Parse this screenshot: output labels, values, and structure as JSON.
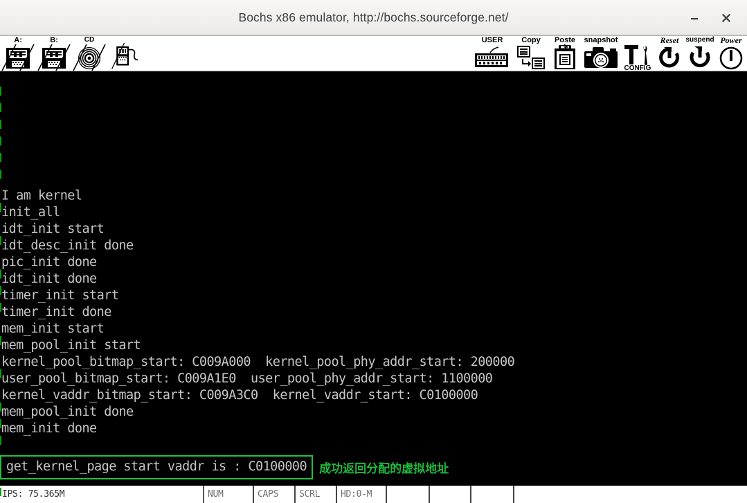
{
  "window": {
    "title": "Bochs x86 emulator, http://bochs.sourceforge.net/",
    "minimize_label": "–",
    "close_label": "×",
    "minimize_icon": "minimize-icon",
    "close_icon": "close-icon"
  },
  "toolbar": {
    "left_items": [
      {
        "label": "A:",
        "icon": "floppy-a-icon",
        "disabled": true
      },
      {
        "label": "B:",
        "icon": "floppy-b-icon",
        "disabled": true
      },
      {
        "label": "CD",
        "icon": "cdrom-icon",
        "disabled": true
      },
      {
        "label": "",
        "icon": "usb-device-icon",
        "disabled": true
      }
    ],
    "right_items": [
      {
        "label": "USER",
        "icon": "keyboard-icon",
        "under": ""
      },
      {
        "label": "Copy",
        "icon": "copy-icon",
        "under": ""
      },
      {
        "label": "Poste",
        "icon": "paste-icon",
        "under": ""
      },
      {
        "label": "snapshot",
        "icon": "camera-icon",
        "under": ""
      },
      {
        "label": "",
        "icon": "config-tools-icon",
        "under": "CONFIG"
      },
      {
        "label": "Reset",
        "icon": "reset-icon",
        "under": ""
      },
      {
        "label": "suspend",
        "icon": "suspend-icon",
        "under": ""
      },
      {
        "label": "Power",
        "icon": "power-icon",
        "under": ""
      }
    ]
  },
  "console": {
    "lines": [
      "",
      "",
      "",
      "",
      "",
      "",
      "",
      "I am kernel",
      "init_all",
      "idt_init start",
      "idt_desc_init done",
      "pic_init done",
      "idt_init done",
      "timer_init start",
      "timer_init done",
      "mem_init start",
      "mem_pool_init start",
      "kernel_pool_bitmap_start: C009A000  kernel_pool_phy_addr_start: 200000",
      "user_pool_bitmap_start: C009A1E0  user_pool_phy_addr_start: 1100000",
      "kernel_vaddr_bitmap_start: C009A3C0  kernel_vaddr_start: C0100000",
      "mem_pool_init done",
      "mem_init done"
    ],
    "highlight": {
      "text": "get_kernel_page start vaddr is : C0100000",
      "annotation": "成功返回分配的虚拟地址",
      "border_color": "#22c040",
      "annotation_color": "#1fb93b"
    },
    "text_color": "#c6c6c6",
    "background_color": "#000000"
  },
  "statusbar": {
    "ips": "IPS: 75.365M",
    "indicators": [
      "NUM",
      "CAPS",
      "SCRL",
      "HD:0-M",
      "",
      "",
      "",
      ""
    ]
  }
}
